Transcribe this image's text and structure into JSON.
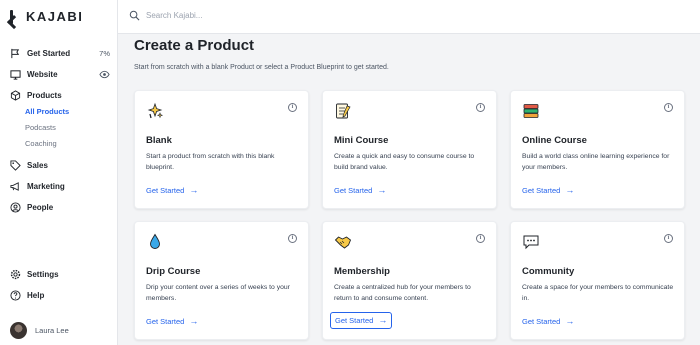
{
  "brand": {
    "name": "KAJABI"
  },
  "search": {
    "placeholder": "Search Kajabi..."
  },
  "sidebar": {
    "items": [
      {
        "label": "Get Started",
        "extra": "7%",
        "icon": "flag-icon"
      },
      {
        "label": "Website",
        "icon": "monitor-icon",
        "trailing_icon": "eye-icon"
      },
      {
        "label": "Products",
        "icon": "box-icon"
      },
      {
        "label": "Sales",
        "icon": "tag-icon"
      },
      {
        "label": "Marketing",
        "icon": "megaphone-icon"
      },
      {
        "label": "People",
        "icon": "user-circle-icon"
      },
      {
        "label": "Settings",
        "icon": "gear-icon"
      },
      {
        "label": "Help",
        "icon": "help-icon"
      }
    ],
    "products_sub": [
      "All Products",
      "Podcasts",
      "Coaching"
    ],
    "active_sub": "All Products"
  },
  "profile": {
    "name": "Laura Lee"
  },
  "page": {
    "title": "Create a Product",
    "subtitle": "Start from scratch with a blank Product or select a Product Blueprint to get started."
  },
  "cards": [
    {
      "title": "Blank",
      "desc": "Start a product from scratch with this blank blueprint.",
      "cta": "Get Started",
      "icon": "sparkle-icon"
    },
    {
      "title": "Mini Course",
      "desc": "Create a quick and easy to consume course to build brand value.",
      "cta": "Get Started",
      "icon": "notepad-icon"
    },
    {
      "title": "Online Course",
      "desc": "Build a world class online learning experience for your members.",
      "cta": "Get Started",
      "icon": "books-icon"
    },
    {
      "title": "Drip Course",
      "desc": "Drip your content over a series of weeks to your members.",
      "cta": "Get Started",
      "icon": "droplet-icon"
    },
    {
      "title": "Membership",
      "desc": "Create a centralized hub for your members to return to and consume content.",
      "cta": "Get Started",
      "icon": "handshake-icon"
    },
    {
      "title": "Community",
      "desc": "Create a space for your members to communicate in.",
      "cta": "Get Started",
      "icon": "chat-bubble-icon"
    }
  ],
  "colors": {
    "accent": "#2563eb",
    "background": "#f3f4f6"
  }
}
